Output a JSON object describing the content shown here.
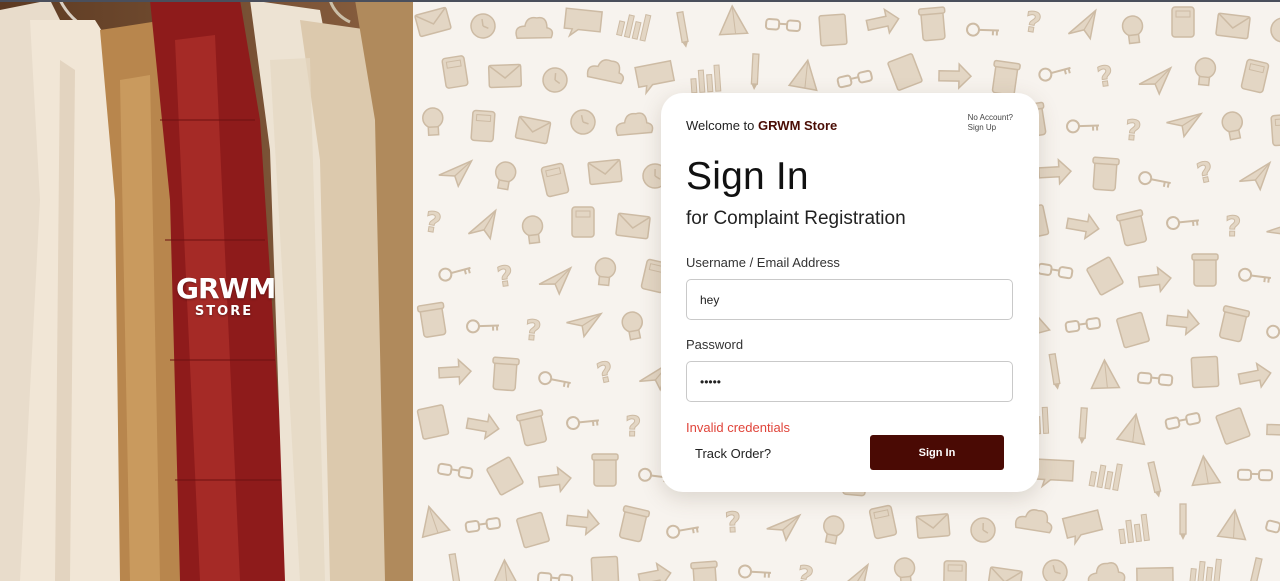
{
  "brand": {
    "name": "GRWM",
    "sub": "STORE"
  },
  "card": {
    "welcome_prefix": "Welcome to",
    "welcome_store": "GRWM Store",
    "no_account": "No Account?",
    "sign_up": "Sign Up",
    "title": "Sign In",
    "subtitle": "for Complaint Registration",
    "username_label": "Username / Email Address",
    "username_value": "hey",
    "password_label": "Password",
    "password_value": "•••••",
    "error": "Invalid credentials",
    "track_order": "Track Order?",
    "submit": "Sign In"
  },
  "colors": {
    "accent": "#4a0a04",
    "error": "#e0443a",
    "pattern_bg": "#f7f3ee",
    "doodle": "#e3d6c4"
  },
  "icons": [
    "envelope-icon",
    "paper-plane-icon",
    "coffee-cup-icon",
    "glasses-icon",
    "bar-chart-icon",
    "clock-icon",
    "lightbulb-icon",
    "key-icon",
    "notebook-icon",
    "pencil-icon",
    "cloud-icon",
    "calculator-icon",
    "question-mark-icon",
    "arrow-icon",
    "pyramid-icon",
    "speech-bubble-icon"
  ]
}
